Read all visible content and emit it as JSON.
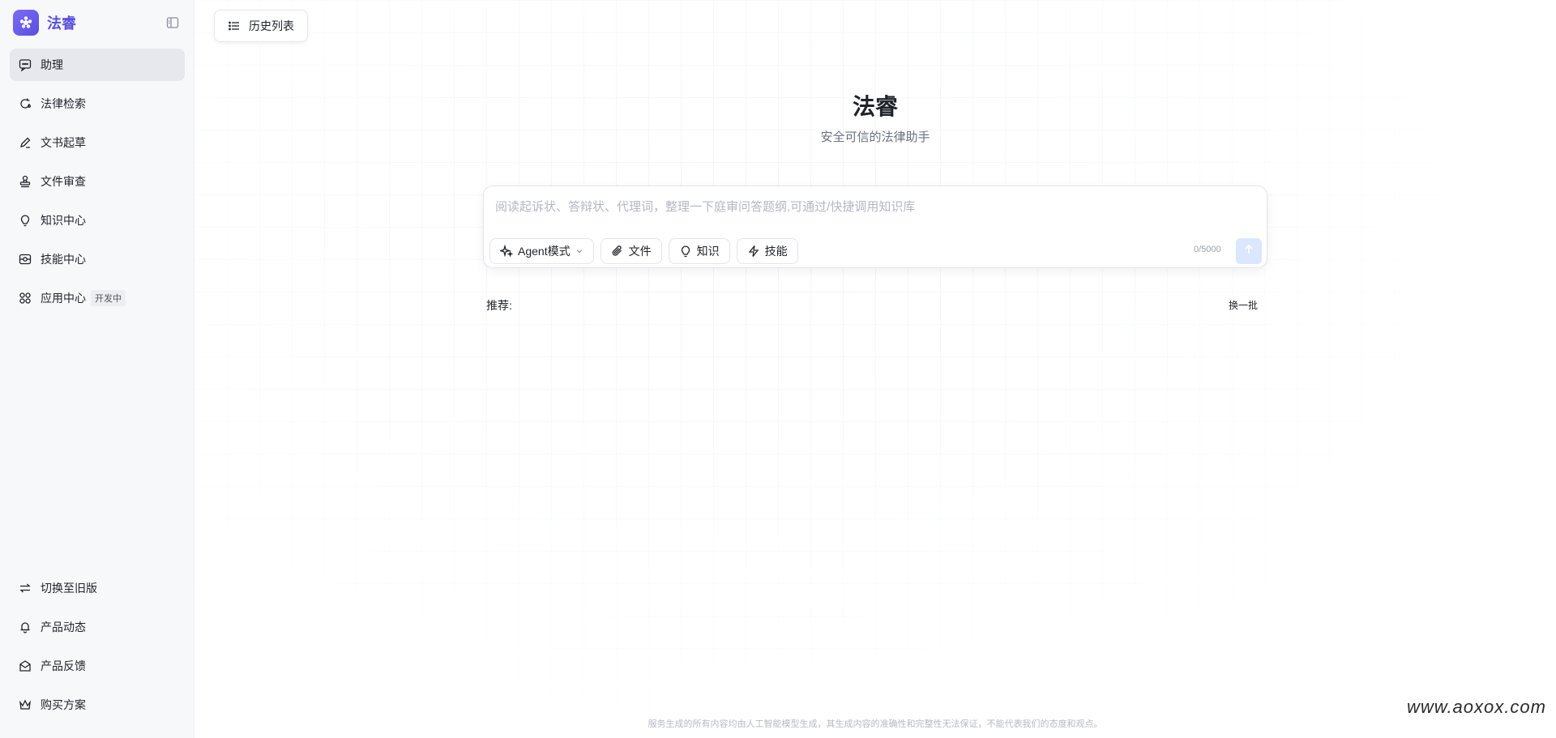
{
  "brand": {
    "name": "法睿"
  },
  "sidebar": {
    "items": [
      {
        "label": "助理",
        "icon": "chat-icon"
      },
      {
        "label": "法律检索",
        "icon": "search-refresh-icon"
      },
      {
        "label": "文书起草",
        "icon": "pen-icon"
      },
      {
        "label": "文件审查",
        "icon": "stamp-icon"
      },
      {
        "label": "知识中心",
        "icon": "bulb-icon"
      },
      {
        "label": "技能中心",
        "icon": "skill-icon"
      },
      {
        "label": "应用中心",
        "icon": "apps-icon",
        "badge": "开发中"
      }
    ],
    "bottom_items": [
      {
        "label": "切换至旧版",
        "icon": "switch-icon"
      },
      {
        "label": "产品动态",
        "icon": "bell-icon"
      },
      {
        "label": "产品反馈",
        "icon": "feedback-icon"
      },
      {
        "label": "购买方案",
        "icon": "crown-icon"
      }
    ]
  },
  "header": {
    "history_label": "历史列表"
  },
  "hero": {
    "title": "法睿",
    "subtitle": "安全可信的法律助手"
  },
  "composer": {
    "placeholder": "阅读起诉状、答辩状、代理词，整理一下庭审问答题纲,可通过/快捷调用知识库",
    "tools": {
      "mode": "Agent模式",
      "file": "文件",
      "knowledge": "知识",
      "skill": "技能"
    },
    "counter": "0/5000"
  },
  "recommend": {
    "label": "推荐:",
    "refresh": "换一批"
  },
  "footer": {
    "disclaimer": "服务生成的所有内容均由人工智能模型生成，其生成内容的准确性和完整性无法保证，不能代表我们的态度和观点。"
  },
  "watermark": "www.aoxox.com",
  "colors": {
    "accent": "#5a4fdc",
    "send_disabled": "#dbe6ff"
  }
}
